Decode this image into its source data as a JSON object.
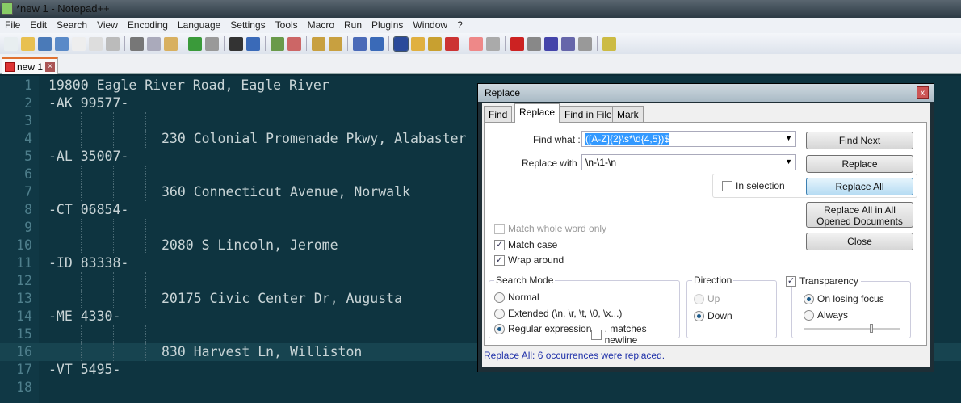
{
  "window": {
    "title": "*new 1 - Notepad++"
  },
  "menu": [
    "File",
    "Edit",
    "Search",
    "View",
    "Encoding",
    "Language",
    "Settings",
    "Tools",
    "Macro",
    "Run",
    "Plugins",
    "Window",
    "?"
  ],
  "toolbar_icons": [
    "new-file",
    "open",
    "save",
    "save-all",
    "close",
    "close-all",
    "print",
    "cut",
    "copy",
    "paste",
    "undo",
    "redo",
    "find",
    "replace",
    "zoom-in",
    "zoom-out",
    "sync-v",
    "sync-h",
    "word-wrap",
    "show-all-chars",
    "indent-guide",
    "udl",
    "doc-map",
    "function-list",
    "folder",
    "monitor",
    "record",
    "stop",
    "play",
    "play-multiple",
    "save-macro",
    "run"
  ],
  "tab": {
    "label": "new 1"
  },
  "editor": {
    "current_line": 16,
    "lines": [
      {
        "n": "1",
        "text": "19800 Eagle River Road, Eagle River",
        "indent": false
      },
      {
        "n": "2",
        "text": "-AK 99577-",
        "indent": false
      },
      {
        "n": "3",
        "text": "",
        "indent": true
      },
      {
        "n": "4",
        "text": "230 Colonial Promenade Pkwy, Alabaster",
        "indent": true
      },
      {
        "n": "5",
        "text": "-AL 35007-",
        "indent": false
      },
      {
        "n": "6",
        "text": "",
        "indent": true
      },
      {
        "n": "7",
        "text": "360 Connecticut Avenue, Norwalk",
        "indent": true
      },
      {
        "n": "8",
        "text": "-CT 06854-",
        "indent": false
      },
      {
        "n": "9",
        "text": "",
        "indent": true
      },
      {
        "n": "10",
        "text": "2080 S Lincoln, Jerome",
        "indent": true
      },
      {
        "n": "11",
        "text": "-ID 83338-",
        "indent": false
      },
      {
        "n": "12",
        "text": "",
        "indent": true
      },
      {
        "n": "13",
        "text": "20175 Civic Center Dr, Augusta",
        "indent": true
      },
      {
        "n": "14",
        "text": "-ME 4330-",
        "indent": false
      },
      {
        "n": "15",
        "text": "",
        "indent": true
      },
      {
        "n": "16",
        "text": "830 Harvest Ln, Williston",
        "indent": true
      },
      {
        "n": "17",
        "text": "-VT 5495-",
        "indent": false
      },
      {
        "n": "18",
        "text": "",
        "indent": false
      }
    ]
  },
  "dialog": {
    "title": "Replace",
    "close": "x",
    "tabs": [
      "Find",
      "Replace",
      "Find in Files",
      "Mark"
    ],
    "find_label": "Find what :",
    "find_value": "([A-Z]{2}\\s*\\d{4,5})$",
    "replace_label": "Replace with :",
    "replace_value": "\\n-\\1-\\n",
    "buttons": {
      "find_next": "Find Next",
      "replace": "Replace",
      "replace_all": "Replace All",
      "replace_all_opened": "Replace All in All Opened Documents",
      "close": "Close"
    },
    "in_selection": "In selection",
    "match_whole_word": "Match whole word only",
    "match_case": "Match case",
    "wrap_around": "Wrap around",
    "search_mode": {
      "label": "Search Mode",
      "normal": "Normal",
      "extended": "Extended (\\n, \\r, \\t, \\0, \\x...)",
      "regex": "Regular expression",
      "dot_newline": ". matches newline"
    },
    "direction": {
      "label": "Direction",
      "up": "Up",
      "down": "Down"
    },
    "transparency": {
      "label": "Transparency",
      "on_losing_focus": "On losing focus",
      "always": "Always",
      "level": 0.7
    },
    "status": "Replace All: 6 occurrences were replaced."
  }
}
